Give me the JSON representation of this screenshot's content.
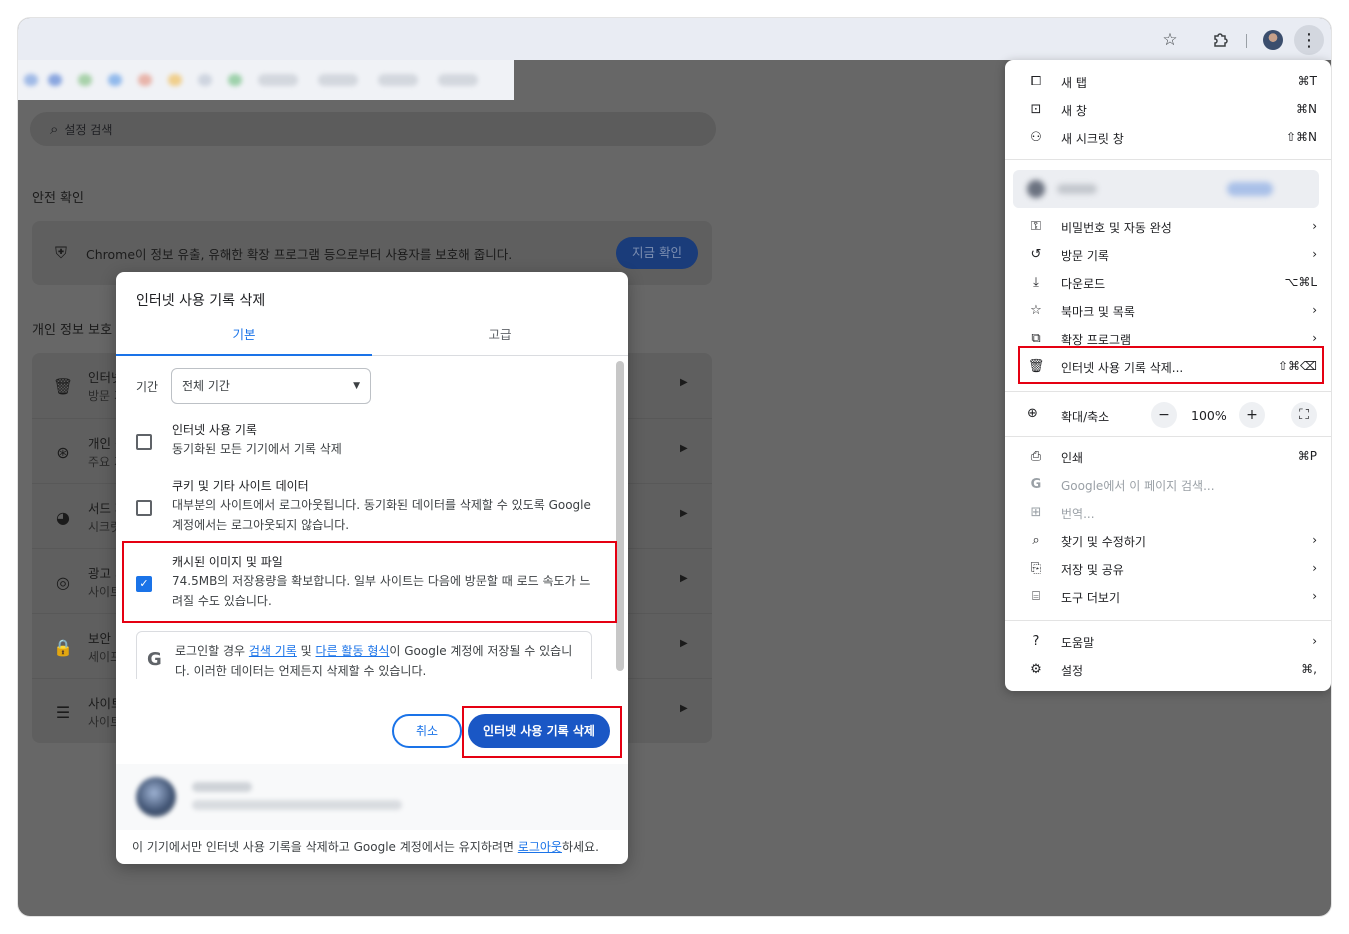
{
  "settings": {
    "search_placeholder": "설정 검색",
    "safety_title": "안전 확인",
    "safety_text": "Chrome이 정보 유출, 유해한 확장 프로그램 등으로부터 사용자를 보호해 줍니다.",
    "safety_button": "지금 확인",
    "privacy_title": "개인 정보 보호",
    "privacy_rows": [
      {
        "l1": "인터넷",
        "l2": "방문 기"
      },
      {
        "l1": "개인 정",
        "l2": "주요 기"
      },
      {
        "l1": "서드 파",
        "l2": "시크릿"
      },
      {
        "l1": "광고 개",
        "l2": "사이트"
      },
      {
        "l1": "보안",
        "l2": "세이프"
      },
      {
        "l1": "사이트",
        "l2": "사이트"
      }
    ]
  },
  "dialog": {
    "title": "인터넷 사용 기록 삭제",
    "tabs": [
      "기본",
      "고급"
    ],
    "period_label": "기간",
    "period_value": "전체 기간",
    "options": [
      {
        "title": "인터넷 사용 기록",
        "desc": "동기화된 모든 기기에서 기록 삭제",
        "checked": false
      },
      {
        "title": "쿠키 및 기타 사이트 데이터",
        "desc": "대부분의 사이트에서 로그아웃됩니다. 동기화된 데이터를 삭제할 수 있도록 Google 계정에서는 로그아웃되지 않습니다.",
        "checked": false
      },
      {
        "title": "캐시된 이미지 및 파일",
        "desc": "74.5MB의 저장용량을 확보합니다. 일부 사이트는 다음에 방문할 때 로드 속도가 느려질 수도 있습니다.",
        "checked": true
      }
    ],
    "info": {
      "prefix": "로그인할 경우 ",
      "link1": "검색 기록",
      "mid": " 및 ",
      "link2": "다른 활동 형식",
      "suffix": "이 Google 계정에 저장될 수 있습니다. 이러한 데이터는 언제든지 삭제할 수 있습니다."
    },
    "cancel_label": "취소",
    "delete_label": "인터넷 사용 기록 삭제",
    "footer_prefix": "이 기기에서만 인터넷 사용 기록을 삭제하고 Google 계정에서는 유지하려면 ",
    "footer_link": "로그아웃",
    "footer_suffix": "하세요."
  },
  "menu": {
    "new_tab": {
      "label": "새 탭",
      "shortcut": "⌘T"
    },
    "new_window": {
      "label": "새 창",
      "shortcut": "⌘N"
    },
    "incognito": {
      "label": "새 시크릿 창",
      "shortcut": "⇧⌘N"
    },
    "passwords": {
      "label": "비밀번호 및 자동 완성"
    },
    "history": {
      "label": "방문 기록"
    },
    "downloads": {
      "label": "다운로드",
      "shortcut": "⌥⌘L"
    },
    "bookmarks": {
      "label": "북마크 및 목록"
    },
    "extensions": {
      "label": "확장 프로그램"
    },
    "clear_data": {
      "label": "인터넷 사용 기록 삭제...",
      "shortcut": "⇧⌘⌫"
    },
    "zoom": {
      "label": "확대/축소",
      "value": "100%"
    },
    "print": {
      "label": "인쇄",
      "shortcut": "⌘P"
    },
    "search_page": {
      "label": "Google에서 이 페이지 검색..."
    },
    "translate": {
      "label": "번역..."
    },
    "find_edit": {
      "label": "찾기 및 수정하기"
    },
    "save_share": {
      "label": "저장 및 공유"
    },
    "more_tools": {
      "label": "도구 더보기"
    },
    "help": {
      "label": "도움말"
    },
    "settings": {
      "label": "설정",
      "shortcut": "⌘,"
    }
  },
  "colors": {
    "accent": "#1a73e8",
    "highlight": "#e50012"
  }
}
